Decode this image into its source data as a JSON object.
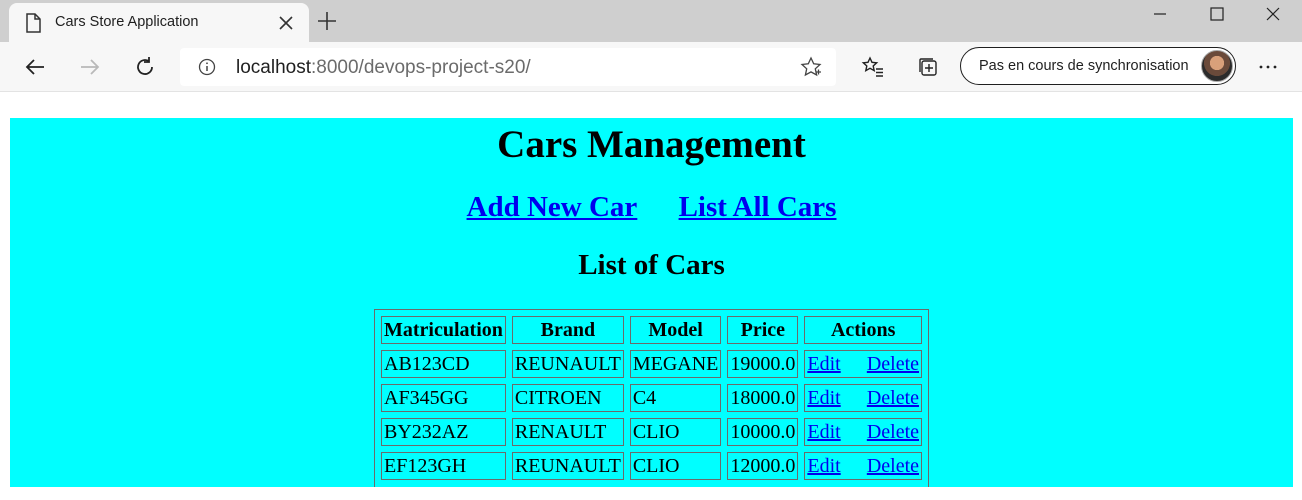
{
  "browser": {
    "tab_title": "Cars Store Application",
    "address_host": "localhost",
    "address_path": ":8000/devops-project-s20/",
    "sync_label": "Pas en cours de synchronisation",
    "icons": [
      "page-icon",
      "close-icon",
      "plus-icon",
      "minimize-icon",
      "maximize-icon",
      "window-close-icon",
      "back-icon",
      "forward-icon",
      "refresh-icon",
      "info-icon",
      "star-icon",
      "favorites-icon",
      "collections-icon",
      "more-icon"
    ]
  },
  "page": {
    "title": "Cars Management",
    "nav": {
      "add_label": "Add New Car",
      "list_label": "List All Cars"
    },
    "list_title": "List of Cars",
    "background": "#00ffff",
    "link_color": "#0000ee",
    "table": {
      "headers": [
        "Matriculation",
        "Brand",
        "Model",
        "Price",
        "Actions"
      ],
      "rows": [
        {
          "matriculation": "AB123CD",
          "brand": "REUNAULT",
          "model": "MEGANE",
          "price": "19000.0",
          "edit": "Edit",
          "delete": "Delete"
        },
        {
          "matriculation": "AF345GG",
          "brand": "CITROEN",
          "model": "C4",
          "price": "18000.0",
          "edit": "Edit",
          "delete": "Delete"
        },
        {
          "matriculation": "BY232AZ",
          "brand": "RENAULT",
          "model": "CLIO",
          "price": "10000.0",
          "edit": "Edit",
          "delete": "Delete"
        },
        {
          "matriculation": "EF123GH",
          "brand": "REUNAULT",
          "model": "CLIO",
          "price": "12000.0",
          "edit": "Edit",
          "delete": "Delete"
        }
      ]
    }
  }
}
